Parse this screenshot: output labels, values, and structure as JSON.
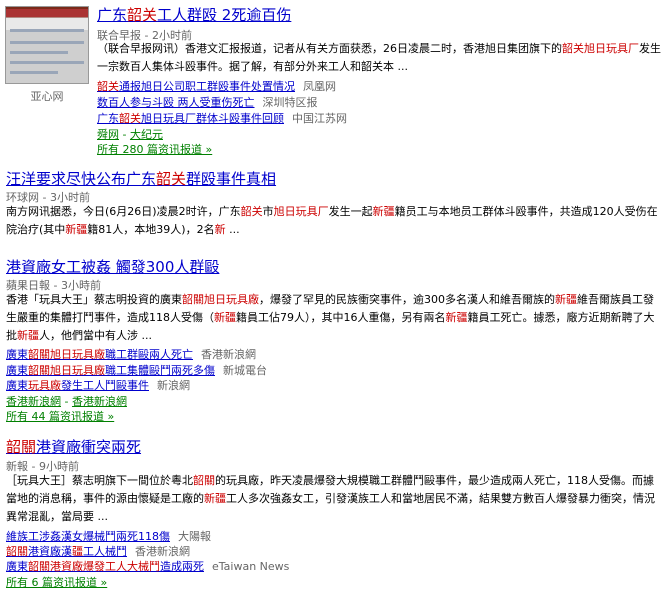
{
  "stories": [
    {
      "thumb_source": "亚心网",
      "title_parts": [
        "广东",
        "韶关",
        "工人群殴 2死逾百伤"
      ],
      "source": "联合早报 - 2小时前",
      "snippet_parts": [
        "（联合早报网讯）香港文汇报报道，记者从有关方面获悉，26日凌晨二时，香港旭日集团旗下的",
        "韶关旭日玩具厂",
        "发生一宗数百人集体斗殴事件。据了解，有部分外来工人和韶关本 ..."
      ],
      "related": [
        {
          "parts": [
            "韶关",
            "通报旭日公司职工群殴事件处置情况"
          ],
          "source": "凤凰网"
        },
        {
          "parts": [
            "数百人参与斗殴 两人受重伤死亡"
          ],
          "source": "深圳特区报"
        },
        {
          "parts": [
            "广东",
            "韶关",
            "旭日玩具厂群体斗殴事件回顾"
          ],
          "source": "中国江苏网"
        },
        {
          "parts": [
            "舜网"
          ],
          "extra": "大纪元"
        }
      ],
      "all_link": "所有 280 篇资讯报道 »"
    },
    {
      "title_parts": [
        "汪洋要求尽快公布广东",
        "韶关",
        "群殴事件真相"
      ],
      "source": "环球网 - 3小时前",
      "snippet_parts": [
        "南方网讯据悉，今日(6月26日)凌晨2时许，广东",
        "韶关",
        "市",
        "旭日玩具厂",
        "发生一起",
        "新疆",
        "籍员工与本地员工群体斗殴事件，共造成120人受伤在院治疗(其中",
        "新疆",
        "籍81人，本地39人)，2名",
        "新",
        " ..."
      ]
    },
    {
      "title_parts": [
        "港資廠女工被姦 觸發300人群毆"
      ],
      "source": "蘋果日報 - 3小時前",
      "snippet_parts": [
        "香港「玩具大王」蔡志明投資的廣東",
        "韶關旭日玩具廠",
        "，爆發了罕見的民族衝突事件，逾300多名漢人和維吾爾族的",
        "新疆",
        "維吾爾族員工發生嚴重的集體打鬥事件，造成118人受傷（",
        "新疆",
        "籍員工佔79人），其中16人重傷，另有兩名",
        "新疆",
        "籍員工死亡。據悉，廠方近期新聘了大批",
        "新疆",
        "人，他們當中有人涉 ..."
      ],
      "related": [
        {
          "parts": [
            "廣東",
            "韶關旭日玩具廠",
            "職工群毆兩人死亡"
          ],
          "source": "香港新浪網"
        },
        {
          "parts": [
            "廣東",
            "韶關旭日玩具廠",
            "職工集體毆鬥兩死多傷"
          ],
          "source": "新城電台"
        },
        {
          "parts": [
            "廣東",
            "玩具廠",
            "發生工人鬥毆事件"
          ],
          "source": "新浪網"
        },
        {
          "parts": [
            "香港新浪網"
          ],
          "extra": "香港新浪網"
        }
      ],
      "all_link": "所有 44 篇资讯报道 »"
    },
    {
      "title_parts": [
        "韶關",
        "港資廠衝突兩死"
      ],
      "source": "新報 - 9小時前",
      "snippet_parts": [
        "［玩具大王］蔡志明旗下一間位於粵北",
        "韶關",
        "的玩具廠，昨天凌晨爆發大規模職工群體鬥毆事件，最少造成兩人死亡，118人受傷。而據當地的消息稱，事件的源由懷疑是工廠的",
        "新疆",
        "工人多次強姦女工，引發漢族工人和當地居民不滿，結果雙方數百人爆發暴力衝突，情況異常混亂，當局要 ..."
      ],
      "related": [
        {
          "parts": [
            "維族工涉姦漢女爆械鬥兩死118傷"
          ],
          "source": "大陽報"
        },
        {
          "parts": [
            "韶關",
            "港資廠漢",
            "疆",
            "工人械鬥"
          ],
          "source": "香港新浪網"
        },
        {
          "parts": [
            "廣東",
            "韶關港資廠爆發工人大械鬥",
            "造成兩死"
          ],
          "source": "eTaiwan News"
        }
      ],
      "all_link": "所有 6 篇资讯报道 »"
    }
  ]
}
